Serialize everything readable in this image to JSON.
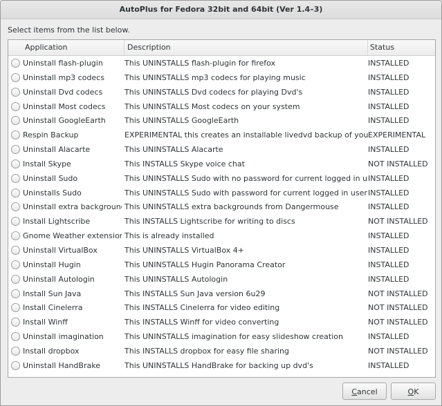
{
  "window": {
    "title": "AutoPlus for Fedora 32bit and 64bit (Ver 1.4–3)"
  },
  "prompt": "Select items from the list below.",
  "columns": {
    "application": "Application",
    "description": "Description",
    "status": "Status"
  },
  "rows": [
    {
      "app": "Uninstall flash-plugin",
      "desc": "This UNINSTALLS flash-plugin for firefox",
      "status": "INSTALLED"
    },
    {
      "app": "Uninstall mp3 codecs",
      "desc": "This UNINSTALLS mp3 codecs for playing music",
      "status": "INSTALLED"
    },
    {
      "app": "Uninstall Dvd codecs",
      "desc": "This UNINSTALLS Dvd codecs for playing Dvd's",
      "status": "INSTALLED"
    },
    {
      "app": "Uninstall Most codecs",
      "desc": "This UNINSTALLS Most codecs on your system",
      "status": "INSTALLED"
    },
    {
      "app": "Uninstall GoogleEarth",
      "desc": "This UNINSTALLS GoogleEarth",
      "status": "INSTALLED"
    },
    {
      "app": "Respin Backup",
      "desc": "EXPERIMENTAL this creates an installable livedvd backup of your os",
      "status": "EXPERIMENTAL"
    },
    {
      "app": "Uninstall Alacarte",
      "desc": "This UNINSTALLS Alacarte",
      "status": "INSTALLED"
    },
    {
      "app": "Install Skype",
      "desc": "This INSTALLS Skype voice chat",
      "status": "NOT INSTALLED"
    },
    {
      "app": "Uninstall Sudo",
      "desc": "This UNINSTALLS Sudo with no password for current logged in user",
      "status": "INSTALLED"
    },
    {
      "app": "Uninstalls Sudo",
      "desc": "This UNINSTALLS Sudo with password for current logged in user",
      "status": "INSTALLED"
    },
    {
      "app": "Uninstall extra backgrounds",
      "desc": "This UNINSTALLS extra backgrounds from Dangermouse",
      "status": "INSTALLED"
    },
    {
      "app": "Install Lightscribe",
      "desc": "This INSTALLS Lightscribe for writing to discs",
      "status": "NOT INSTALLED"
    },
    {
      "app": "Gnome Weather extension",
      "desc": "This is already installed",
      "status": "INSTALLED"
    },
    {
      "app": "Uninstall VirtualBox",
      "desc": "This UNINSTALLS VirtualBox 4+",
      "status": "INSTALLED"
    },
    {
      "app": "Uninstall Hugin",
      "desc": "This UNINSTALLS Hugin Panorama Creator",
      "status": "INSTALLED"
    },
    {
      "app": "Uninstall Autologin",
      "desc": "This UNINSTALLS Autologin",
      "status": "INSTALLED"
    },
    {
      "app": "Install Sun Java",
      "desc": "This INSTALLS Sun Java version 6u29",
      "status": "NOT INSTALLED"
    },
    {
      "app": "Install Cinelerra",
      "desc": "This INSTALLS Cinelerra for video editing",
      "status": "NOT INSTALLED"
    },
    {
      "app": "Install Winff",
      "desc": "This INSTALLS Winff for video converting",
      "status": "NOT INSTALLED"
    },
    {
      "app": "Uninstall imagination",
      "desc": "This UNINSTALLS imagination for easy slideshow creation",
      "status": "INSTALLED"
    },
    {
      "app": "Install dropbox",
      "desc": "This INSTALLS dropbox for easy file sharing",
      "status": "NOT INSTALLED"
    },
    {
      "app": "Uninstall HandBrake",
      "desc": "This UNINSTALLS HandBrake for backing up dvd's",
      "status": "INSTALLED"
    }
  ],
  "buttons": {
    "cancel_mnemonic": "C",
    "cancel_rest": "ancel",
    "ok_mnemonic": "O",
    "ok_rest": "K"
  }
}
